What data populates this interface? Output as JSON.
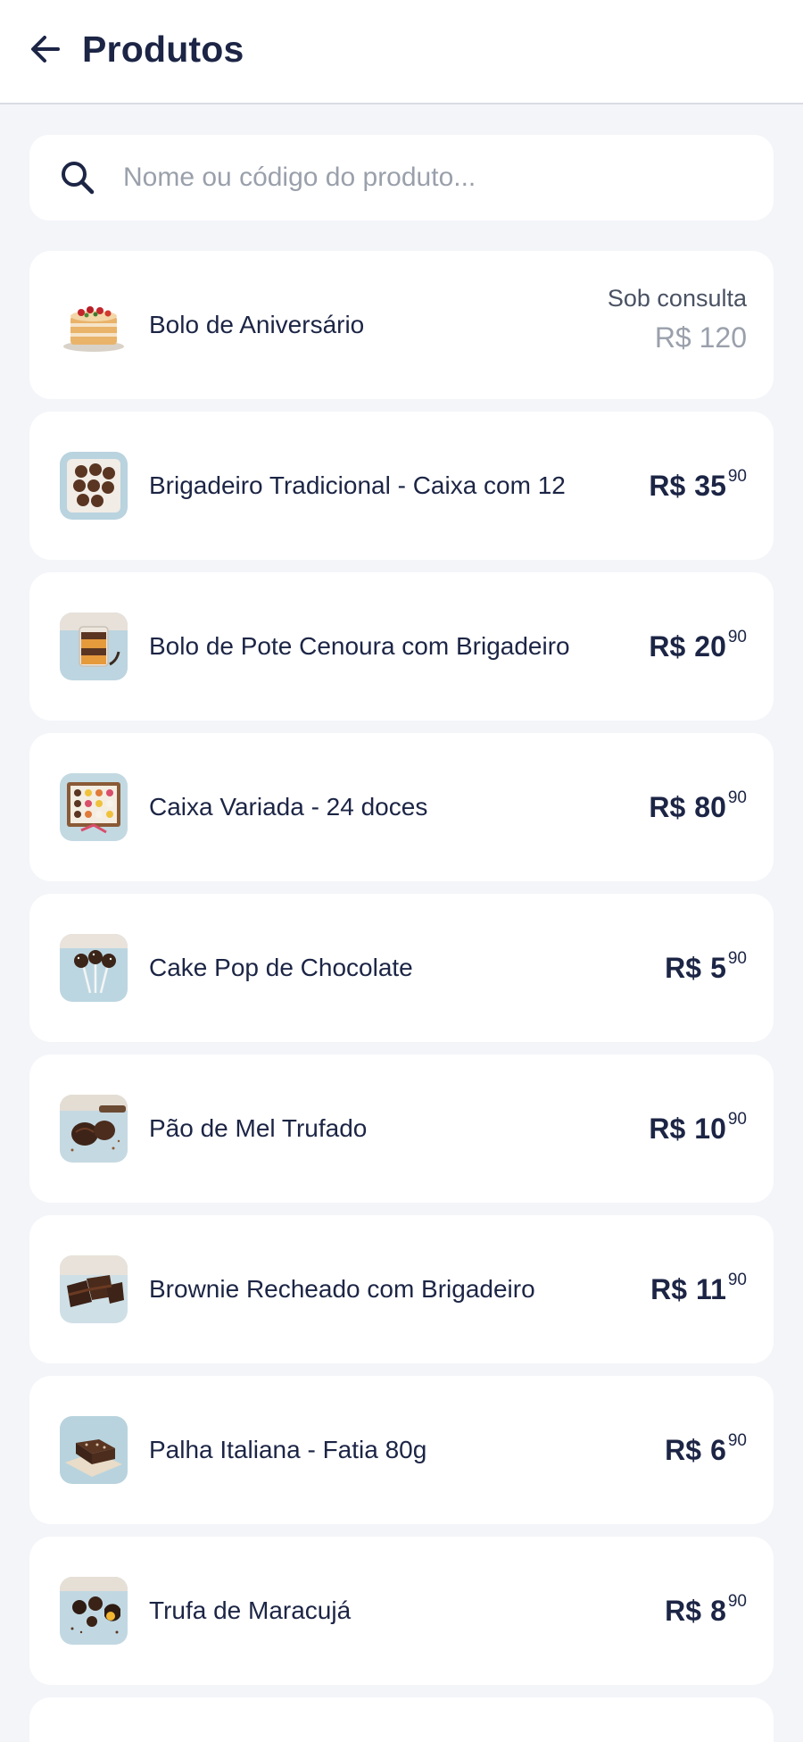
{
  "header": {
    "title": "Produtos"
  },
  "search": {
    "placeholder": "Nome ou código do produto..."
  },
  "products": [
    {
      "name": "Bolo de Aniversário",
      "price_note": "Sob consulta",
      "price_text": "R$ 120",
      "thumb": "birthday-cake-image"
    },
    {
      "name": "Brigadeiro Tradicional - Caixa com 12",
      "currency": "R$",
      "price_int": "35",
      "price_cents": "90",
      "thumb": "brigadeiro-box-image"
    },
    {
      "name": "Bolo de Pote Cenoura com Brigadeiro",
      "currency": "R$",
      "price_int": "20",
      "price_cents": "90",
      "thumb": "cake-jar-image"
    },
    {
      "name": "Caixa Variada - 24 doces",
      "currency": "R$",
      "price_int": "80",
      "price_cents": "90",
      "thumb": "mixed-box-image"
    },
    {
      "name": "Cake Pop de Chocolate",
      "currency": "R$",
      "price_int": "5",
      "price_cents": "90",
      "thumb": "cake-pop-image"
    },
    {
      "name": "Pão de Mel Trufado",
      "currency": "R$",
      "price_int": "10",
      "price_cents": "90",
      "thumb": "honey-bread-image"
    },
    {
      "name": "Brownie Recheado com Brigadeiro",
      "currency": "R$",
      "price_int": "11",
      "price_cents": "90",
      "thumb": "brownie-image"
    },
    {
      "name": "Palha Italiana - Fatia 80g",
      "currency": "R$",
      "price_int": "6",
      "price_cents": "90",
      "thumb": "palha-italiana-image"
    },
    {
      "name": "Trufa de Maracujá",
      "currency": "R$",
      "price_int": "8",
      "price_cents": "90",
      "thumb": "truffle-image"
    }
  ],
  "colors": {
    "background": "#f4f5f9",
    "text": "#1c2545",
    "muted": "#9aa0ab",
    "card": "#ffffff"
  }
}
